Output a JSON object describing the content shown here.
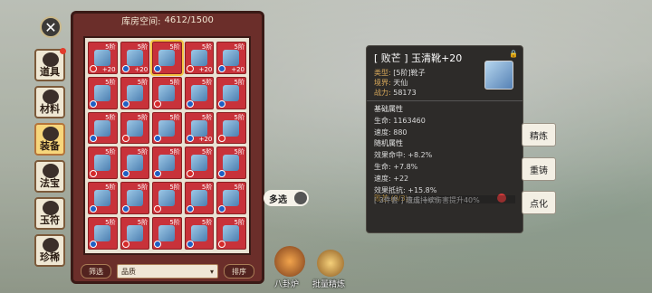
{
  "storage": {
    "label": "库房空间:",
    "value": "4612/1500"
  },
  "side_tabs": [
    "道具",
    "材料",
    "装备",
    "法宝",
    "玉符",
    "珍稀"
  ],
  "active_tab": "装备",
  "grid": {
    "tier_label": "5阶",
    "cells": [
      [
        "+20",
        "+20",
        "",
        "+20",
        "+20"
      ],
      [
        "",
        "",
        "",
        "",
        ""
      ],
      [
        "",
        "",
        "",
        "+20",
        ""
      ],
      [
        "",
        "",
        "",
        "",
        ""
      ],
      [
        "",
        "",
        "",
        "",
        ""
      ],
      [
        "",
        "",
        "",
        "",
        ""
      ]
    ]
  },
  "filters": {
    "left": "筛选",
    "select": "品质",
    "right": "排序"
  },
  "multi_select": "多选",
  "tooltip": {
    "title": "[ 败芒 ] 玉清靴+20",
    "type_k": "类型:",
    "type_v": "[5阶]靴子",
    "realm_k": "境界:",
    "realm_v": "天仙",
    "power_k": "战力:",
    "power_v": "58173",
    "base_title": "基础属性",
    "base": [
      "生命: 1163460",
      "速度: 880"
    ],
    "rand_title": "随机属性",
    "rand": [
      "效果命中: +8.2%",
      "生命: +7.8%",
      "速度: +22",
      "效果抵抗: +15.8%"
    ],
    "set_title": "败芒  (0/3)",
    "set": [
      "[ 2件套 ] 攻击 +6%",
      "[ 3件套 ] 造成持续伤害提升40%"
    ]
  },
  "actions": [
    "精炼",
    "重铸",
    "点化"
  ],
  "bottom": {
    "bagua": "八卦炉",
    "batch": "批量精炼"
  }
}
